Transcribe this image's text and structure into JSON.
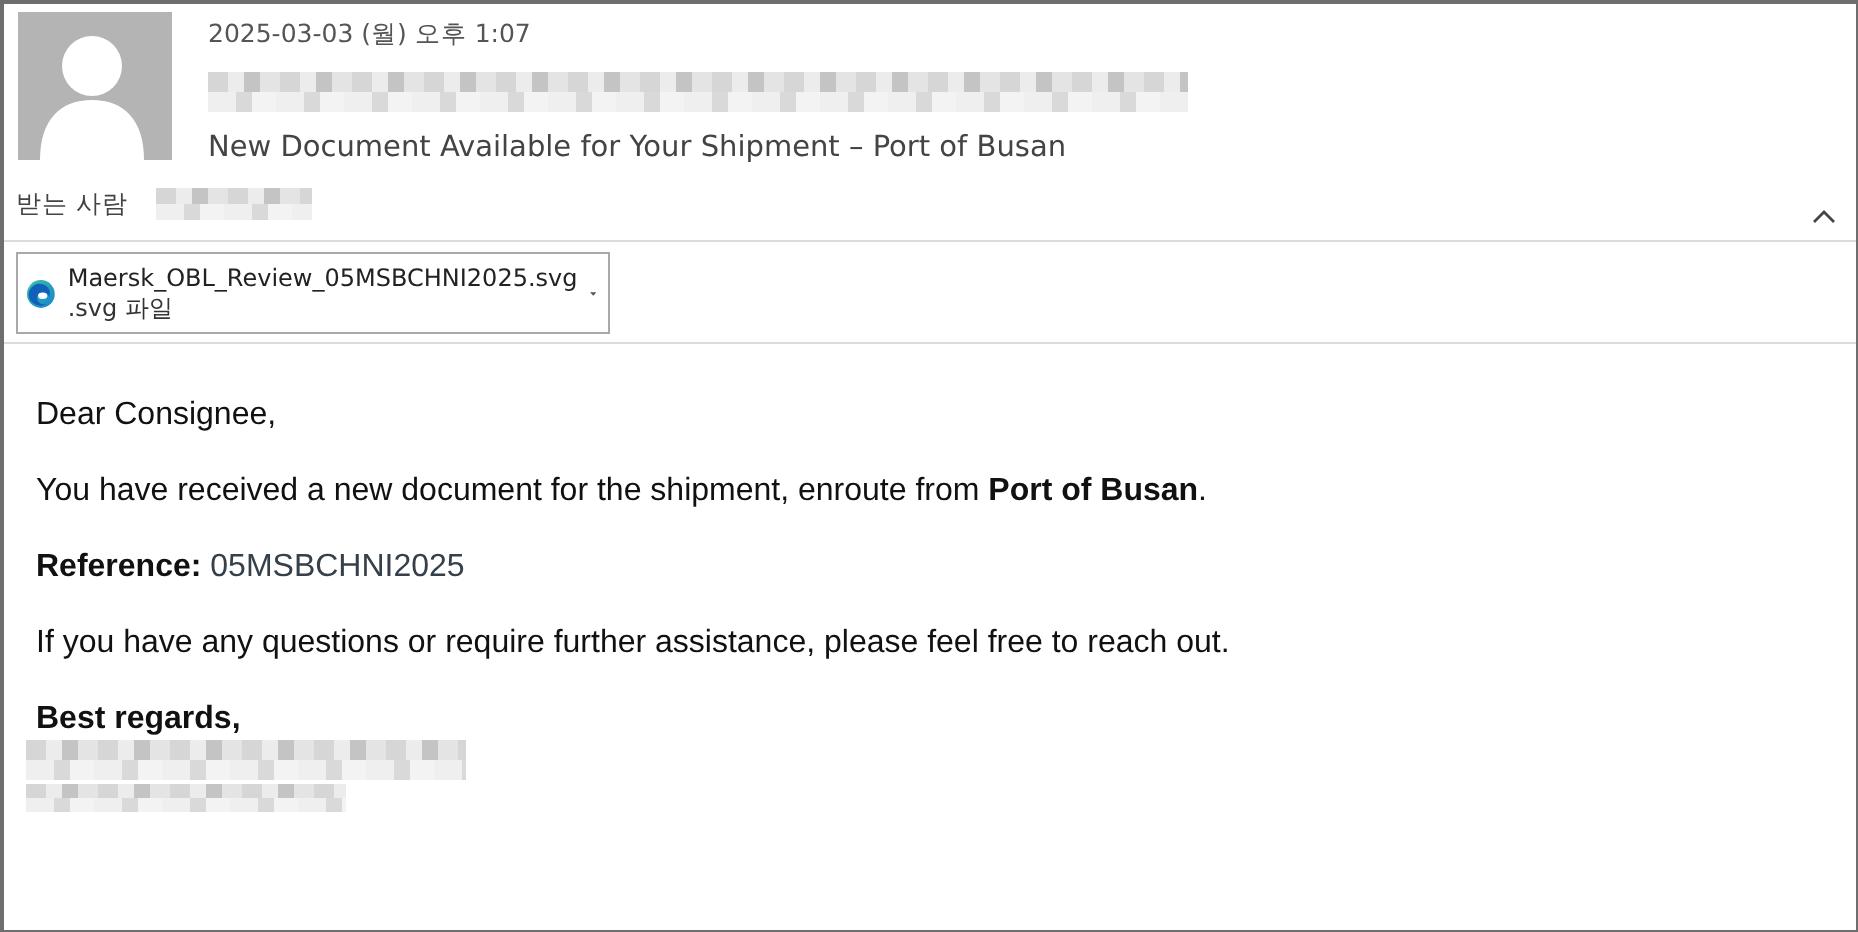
{
  "message": {
    "date": "2025-03-03 (월) 오후 1:07",
    "subject": "New Document Available for Your Shipment – Port of Busan",
    "to_label": "받는 사람",
    "expanded": true
  },
  "attachment": {
    "name": "Maersk_OBL_Review_05MSBCHNI2025.svg",
    "type": ".svg 파일"
  },
  "body": [
    {
      "kind": "text",
      "text": "Dear Consignee,"
    },
    {
      "kind": "text",
      "text": "You have received a new document for the shipment, enroute from **Port of Busan**."
    },
    {
      "kind": "reference",
      "label": "Reference:",
      "value": "05MSBCHNI2025"
    },
    {
      "kind": "text",
      "text": "If you have any questions or require further assistance, please feel free to reach out."
    },
    {
      "kind": "signoff",
      "text": "Best regards,"
    }
  ]
}
